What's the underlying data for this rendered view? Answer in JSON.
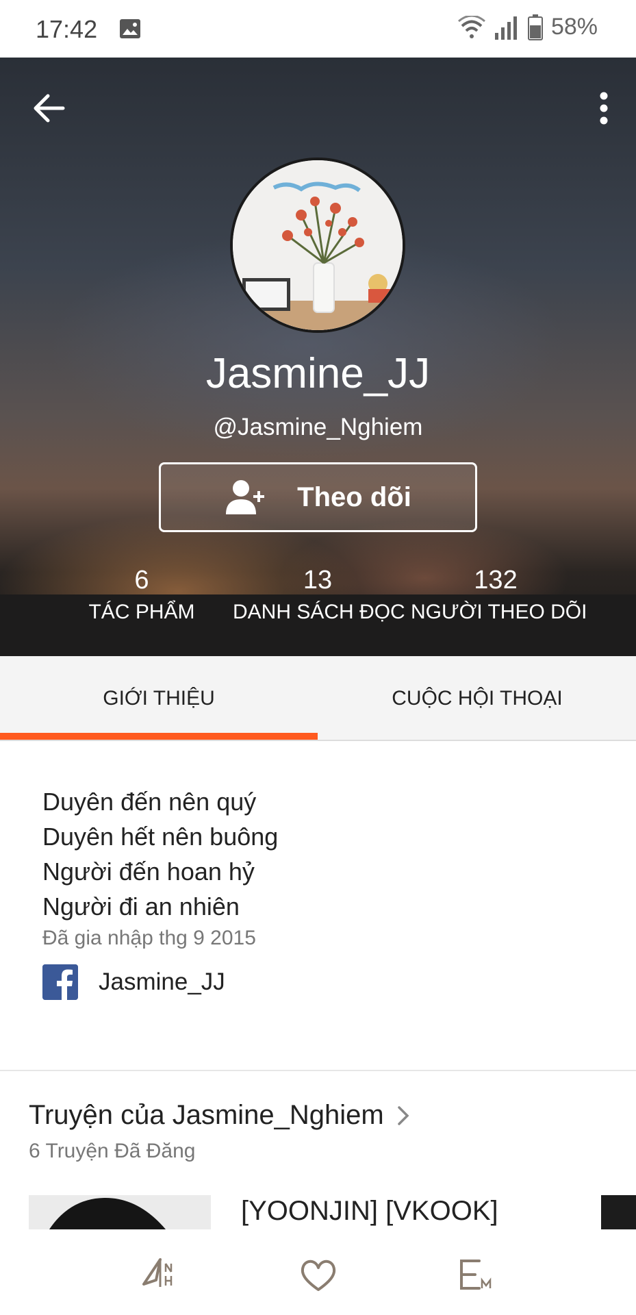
{
  "status_bar": {
    "time": "17:42",
    "battery": "58%",
    "icons": [
      "image-icon",
      "wifi-icon",
      "signal-icon",
      "battery-icon"
    ]
  },
  "profile": {
    "display_name": "Jasmine_JJ",
    "username": "@Jasmine_Nghiem",
    "follow_label": "Theo dõi",
    "stats": [
      {
        "value": "6",
        "label": "TÁC PHẨM"
      },
      {
        "value": "13",
        "label": "DANH SÁCH ĐỌC"
      },
      {
        "value": "132",
        "label": "NGƯỜI THEO DÕI"
      }
    ]
  },
  "tabs": [
    {
      "label": "GIỚI THIỆU",
      "active": true
    },
    {
      "label": "CUỘC HỘI THOẠI",
      "active": false
    }
  ],
  "about": {
    "bio": [
      "Duyên đến nên quý",
      "Duyên hết nên buông",
      "Người đến hoan hỷ",
      "Người đi an nhiên"
    ],
    "joined": "Đã gia nhập thg 9 2015",
    "facebook": "Jasmine_JJ"
  },
  "stories": {
    "title": "Truyện của Jasmine_Nghiem",
    "count": "6 Truyện Đã Đăng",
    "first_title": "[YOONJIN] [VKOOK]"
  },
  "colors": {
    "accent": "#ff5a1f",
    "facebook": "#3b5998"
  }
}
